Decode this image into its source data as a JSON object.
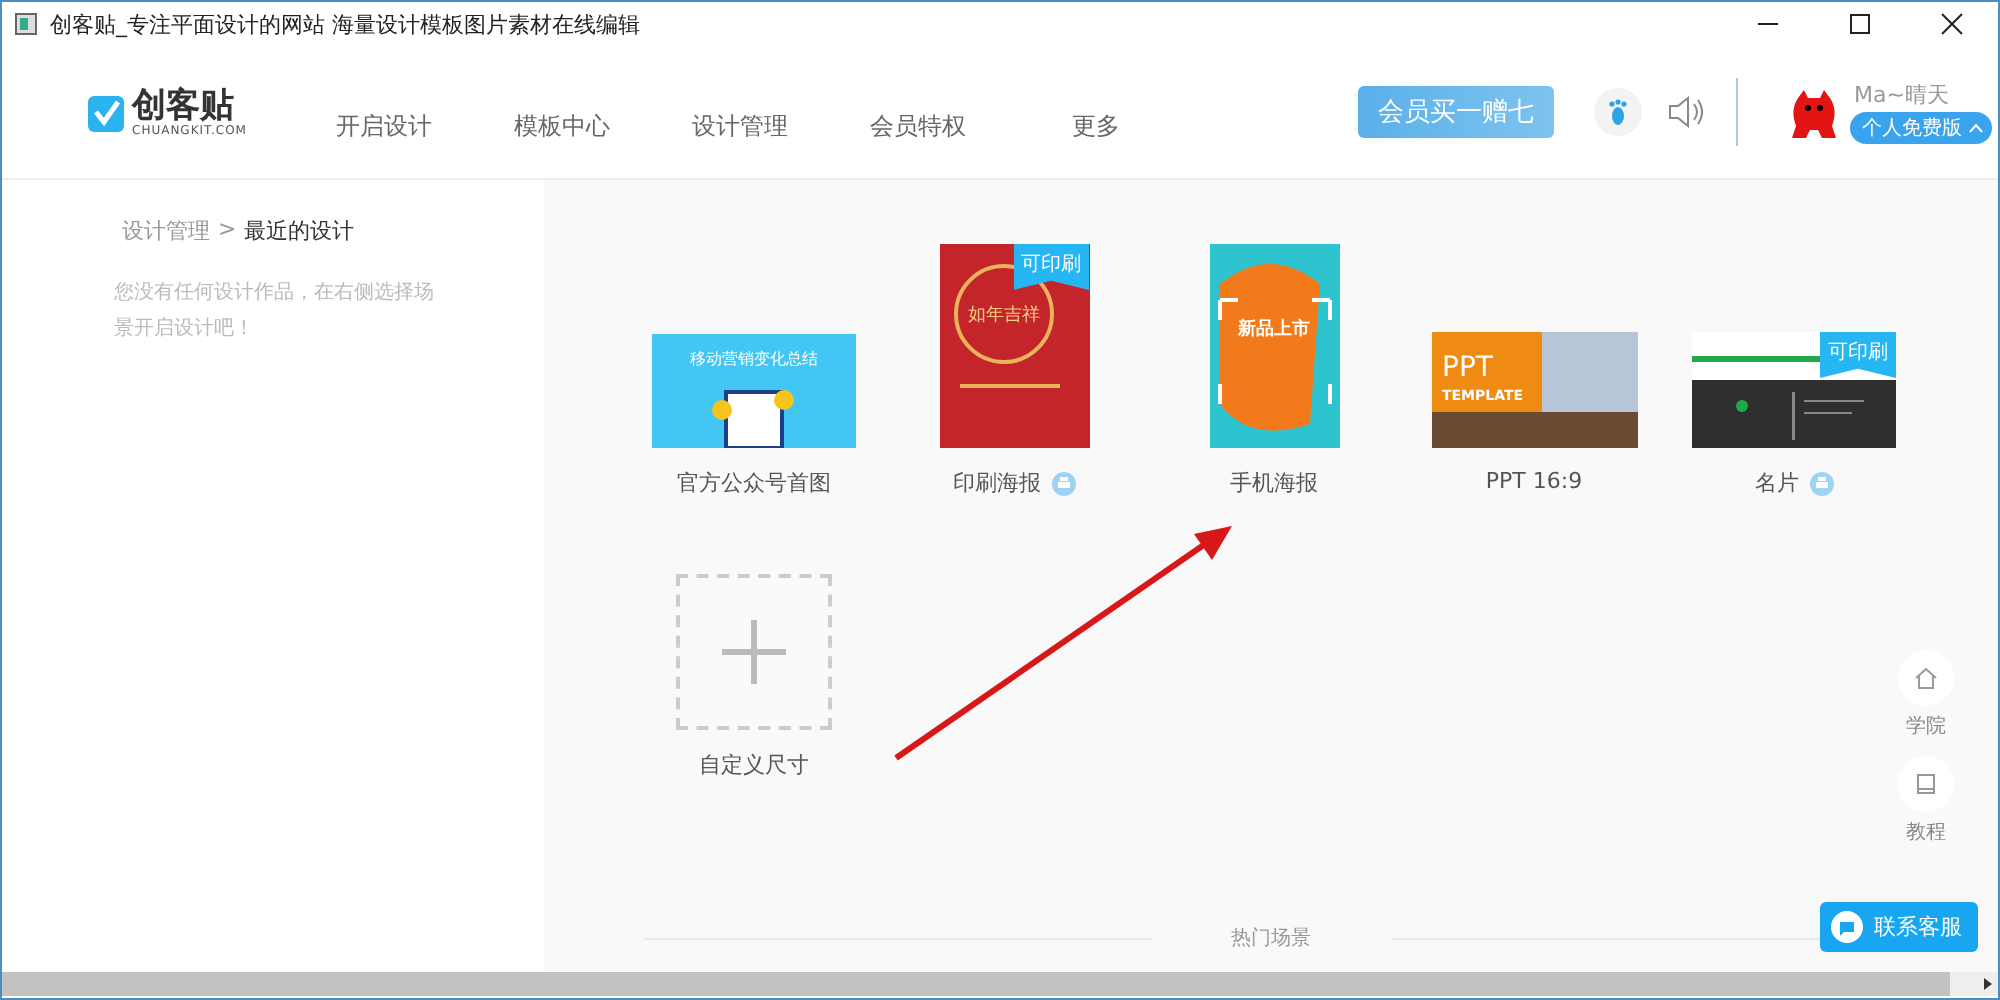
{
  "window": {
    "title": "创客贴_专注平面设计的网站 海量设计模板图片素材在线编辑"
  },
  "header": {
    "logo": {
      "name": "创客贴",
      "domain": "CHUANGKIT.COM"
    },
    "nav": [
      {
        "label": "开启设计"
      },
      {
        "label": "模板中心"
      },
      {
        "label": "设计管理"
      },
      {
        "label": "会员特权"
      },
      {
        "label": "更多"
      }
    ],
    "promo": "会员买一赠七",
    "user": {
      "name": "Ma~晴天",
      "plan": "个人免费版"
    }
  },
  "sidebar": {
    "breadcrumb": {
      "parent": "设计管理",
      "separator": ">",
      "current": "最近的设计"
    },
    "message": "您没有任何设计作品，在右侧选择场景开启设计吧！"
  },
  "templates": [
    {
      "kind": "wechat-cover",
      "label": "官方公众号首图",
      "cover_text": "移动营销变化总结",
      "printable": false
    },
    {
      "kind": "red-poster",
      "label": "印刷海报",
      "cover_text": "如年吉祥",
      "printable": true,
      "badge": "可印刷"
    },
    {
      "kind": "orange-poster",
      "label": "手机海报",
      "cover_text": "新品上市",
      "printable": false
    },
    {
      "kind": "ppt",
      "label": "PPT 16:9",
      "cover_text": "PPT",
      "cover_subtext": "TEMPLATE",
      "printable": false
    },
    {
      "kind": "business-card",
      "label": "名片",
      "printable": true,
      "badge": "可印刷"
    }
  ],
  "custom_size": {
    "label": "自定义尺寸"
  },
  "side_links": [
    {
      "kind": "home",
      "label": "学院"
    },
    {
      "kind": "book",
      "label": "教程"
    }
  ],
  "hot_scenes": {
    "label": "热门场景"
  },
  "contact_button": "联系客服"
}
